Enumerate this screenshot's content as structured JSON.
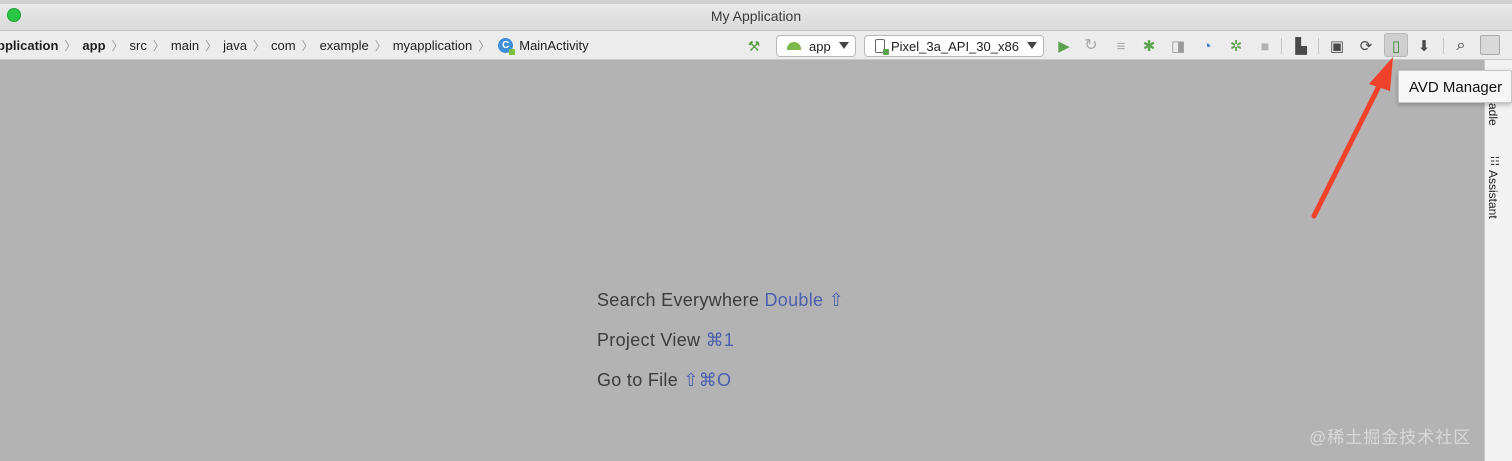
{
  "window": {
    "title": "My Application"
  },
  "breadcrumbs": [
    {
      "label": "pplication",
      "bold": true
    },
    {
      "label": "app",
      "bold": true
    },
    {
      "label": "src"
    },
    {
      "label": "main"
    },
    {
      "label": "java"
    },
    {
      "label": "com"
    },
    {
      "label": "example"
    },
    {
      "label": "myapplication"
    },
    {
      "label": "MainActivity"
    }
  ],
  "toolbar": {
    "config_select": "app",
    "device_select": "Pixel_3a_API_30_x86",
    "icons": [
      "hammer-icon",
      "run-icon",
      "apply-changes-icon",
      "apply-code-changes-icon",
      "debug-icon",
      "attach-debugger-icon",
      "profile-icon",
      "debug-bug-icon",
      "stop-icon",
      "project-structure-icon",
      "terminal-icon",
      "sync-icon",
      "avd-manager-icon",
      "sdk-manager-icon",
      "search-icon",
      "avatar-icon"
    ]
  },
  "tooltip": {
    "text": "AVD Manager"
  },
  "sidebar": {
    "gradle": "adle",
    "assistant": "Assistant"
  },
  "hints": [
    {
      "action": "Search Everywhere",
      "shortcut": "Double ⇧"
    },
    {
      "action": "Project View",
      "shortcut": "⌘1"
    },
    {
      "action": "Go to File",
      "shortcut": "⇧⌘O"
    }
  ],
  "watermark": "@稀土掘金技术社区",
  "colors": {
    "accent": "#4c5fb0",
    "arrow": "#f0412a",
    "run": "#58a34b"
  }
}
